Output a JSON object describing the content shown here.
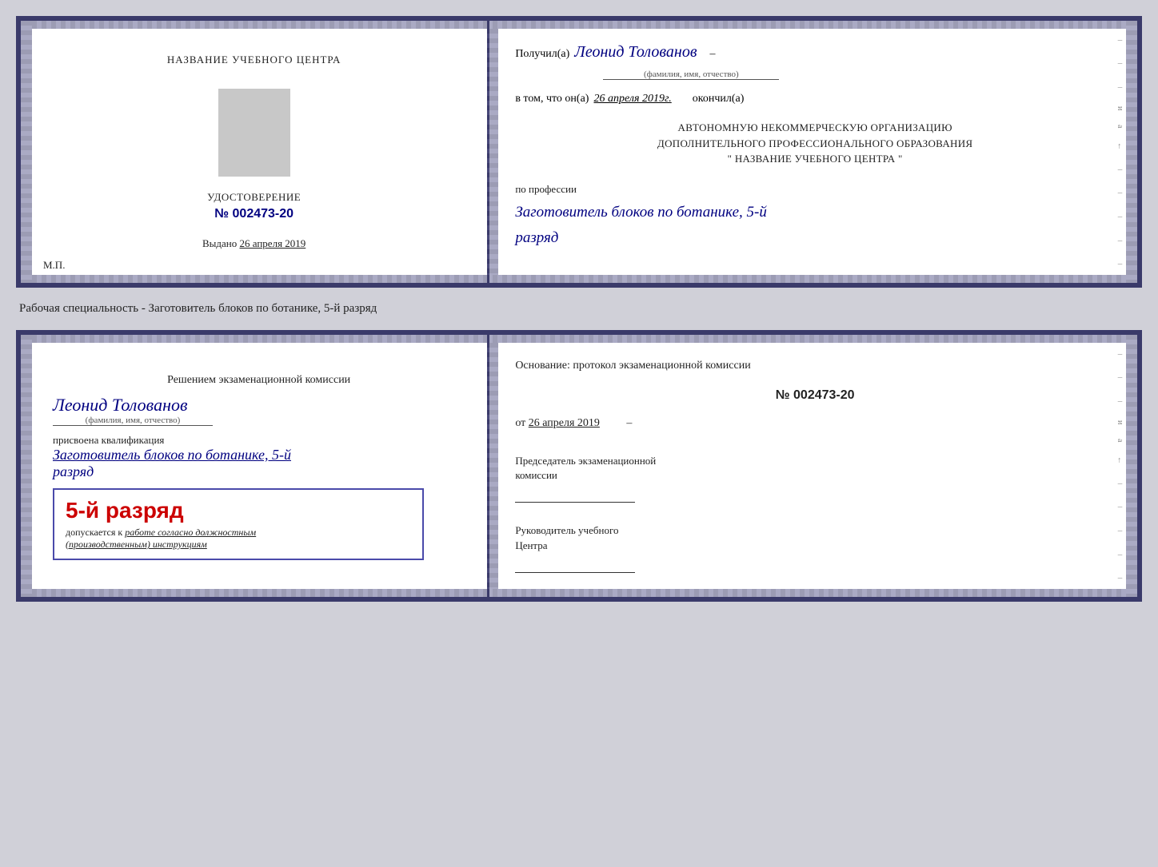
{
  "card1": {
    "left": {
      "training_center_label": "НАЗВАНИЕ УЧЕБНОГО ЦЕНТРА",
      "cert_title": "УДОСТОВЕРЕНИЕ",
      "cert_number": "№ 002473-20",
      "issued_label": "Выдано",
      "issued_date": "26 апреля 2019",
      "mp_label": "М.П."
    },
    "right": {
      "received_prefix": "Получил(а)",
      "person_name": "Леонид Толованов",
      "person_name_note": "(фамилия, имя, отчество)",
      "date_prefix": "в том, что он(а)",
      "date_value": "26 апреля 2019г.",
      "date_suffix": "окончил(а)",
      "org_line1": "АВТОНОМНУЮ НЕКОММЕРЧЕСКУЮ ОРГАНИЗАЦИЮ",
      "org_line2": "ДОПОЛНИТЕЛЬНОГО ПРОФЕССИОНАЛЬНОГО ОБРАЗОВАНИЯ",
      "org_line3": "\" НАЗВАНИЕ УЧЕБНОГО ЦЕНТРА \"",
      "profession_label": "по профессии",
      "profession_text": "Заготовитель блоков по ботанике, 5-й",
      "razryad_text": "разряд"
    }
  },
  "specialty_label": "Рабочая специальность - Заготовитель блоков по ботанике, 5-й разряд",
  "card2": {
    "left": {
      "decision_label": "Решением экзаменационной комиссии",
      "person_name": "Леонид Толованов",
      "person_name_note": "(фамилия, имя, отчество)",
      "qualification_label": "присвоена квалификация",
      "qualification_text": "Заготовитель блоков по ботанике, 5-й",
      "razryad_text": "разряд",
      "badge_text": "5-й разряд",
      "allowed_prefix": "допускается к",
      "allowed_text": "работе согласно должностным",
      "allowed_text2": "(производственным) инструкциям"
    },
    "right": {
      "basis_label": "Основание: протокол экзаменационной комиссии",
      "protocol_number": "№ 002473-20",
      "date_prefix": "от",
      "date_value": "26 апреля 2019",
      "chairman_label": "Председатель экзаменационной",
      "chairman_label2": "комиссии",
      "head_label": "Руководитель учебного",
      "head_label2": "Центра"
    }
  }
}
